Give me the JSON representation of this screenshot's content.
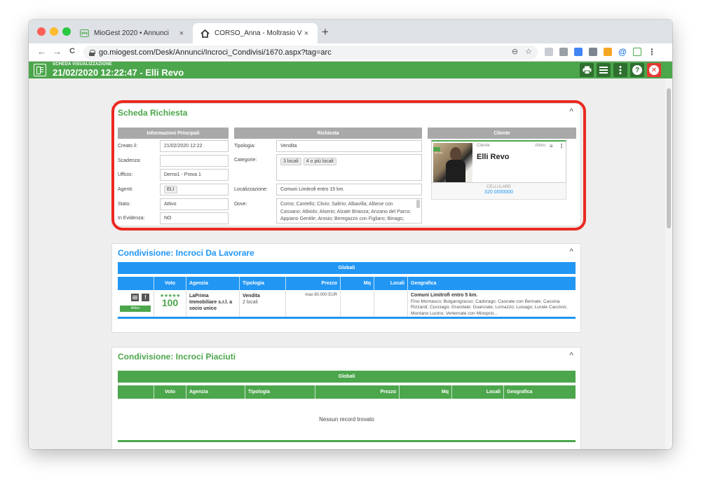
{
  "browser": {
    "tabs": [
      {
        "title": "MioGest 2020 • Annunci",
        "close": "×"
      },
      {
        "title": "CORSO_Anna - Moltrasio Via Re",
        "close": "×"
      }
    ],
    "new_tab": "+",
    "url": "go.miogest.com/Desk/Annunci/Incroci_Condivisi/1670.aspx?tag=arc",
    "nav": {
      "back": "←",
      "forward": "→",
      "reload": "C"
    },
    "omnibox_icons": {
      "zoom": "⊖",
      "star": "☆"
    }
  },
  "app_header": {
    "subtitle": "SCHEDA VISUALIZZAZIONE",
    "title": "21/02/2020 12:22:47 - Elli Revo",
    "colors": {
      "header": "#4ca64c",
      "button": "#2f6f2f",
      "close": "#e53935"
    }
  },
  "scheda": {
    "title": "Scheda Richiesta",
    "title_color": "#4ca64c",
    "columns": {
      "info": "Informazioni Principali",
      "richiesta": "Richiesta",
      "cliente": "Cliente"
    },
    "info_fields": [
      {
        "label": "Creato il:",
        "value": "21/02/2020 12:22"
      },
      {
        "label": "Scadenza:",
        "value": ""
      },
      {
        "label": "Ufficio:",
        "value": "Demo1 - Prova 1"
      },
      {
        "label": "Agenti:",
        "value": "ELI"
      },
      {
        "label": "Stato:",
        "value": "Attivo"
      },
      {
        "label": "In Evidenza:",
        "value": "NO"
      }
    ],
    "richiesta_fields": {
      "tipologia_label": "Tipologia:",
      "tipologia": "Vendita",
      "categorie_label": "Categorie:",
      "categorie": [
        "3 locali",
        "4 o più locali"
      ],
      "localizzazione_label": "Localizzazione:",
      "localizzazione": "Comuni Limitrofi entro 15 km.",
      "dove_label": "Dove:",
      "dove": "Como; Cantello; Clivio; Saltrio; Albavilla; Albese con Cassano; Albiolo; Alserio; Alzate Brianza; Anzano del Parco; Appiano Gentile; Arosio; Beregazzo con Figliaro; Binago; Blevio; Brenna; Brunate; Bulgarograsso"
    },
    "cliente": {
      "role": "Cliente",
      "status": "Attivo",
      "name": "Elli Revo",
      "phone_label": "CELLULARE",
      "phone": "320 0000000",
      "photo_caption": "Alto Ado..."
    }
  },
  "incroci_lavorare": {
    "title": "Condivisione: Incroci Da Lavorare",
    "title_color": "#2196f3",
    "group": "Globali",
    "headers": [
      "",
      "Voto",
      "Agenzia",
      "Tipologia",
      "Prezzo",
      "Mq",
      "Locali",
      "Geografica"
    ],
    "row": {
      "status": "Attivo",
      "stars": "★★★★★",
      "voto": "100",
      "agenzia": "LaPrima Immobiliare s.r.l. a socio unico",
      "tipologia": "Vendita",
      "tipologia_sub": "2 locali",
      "prezzo": "max 80.000 EUR",
      "mq": "",
      "locali": "",
      "geografica_title": "Comuni Limitrofi entro 5 km.",
      "geografica": "Fino Mornasco; Bulgarograsso; Cadorago; Casnate con Bernate; Cassina Rizzardi; Cucciago; Grandate; Guanzate; Lomazzo; Luisago; Lurate Caccivio; Montano Lucino; Vertemate con Minoprio..."
    }
  },
  "incroci_piaciuti": {
    "title": "Condivisione: Incroci Piaciuti",
    "title_color": "#4ca64c",
    "group": "Globali",
    "headers": [
      "",
      "Voto",
      "Agenzia",
      "Tipologia",
      "Prezzo",
      "Mq",
      "Locali",
      "Geografica"
    ],
    "empty": "Nessun record trovato"
  }
}
